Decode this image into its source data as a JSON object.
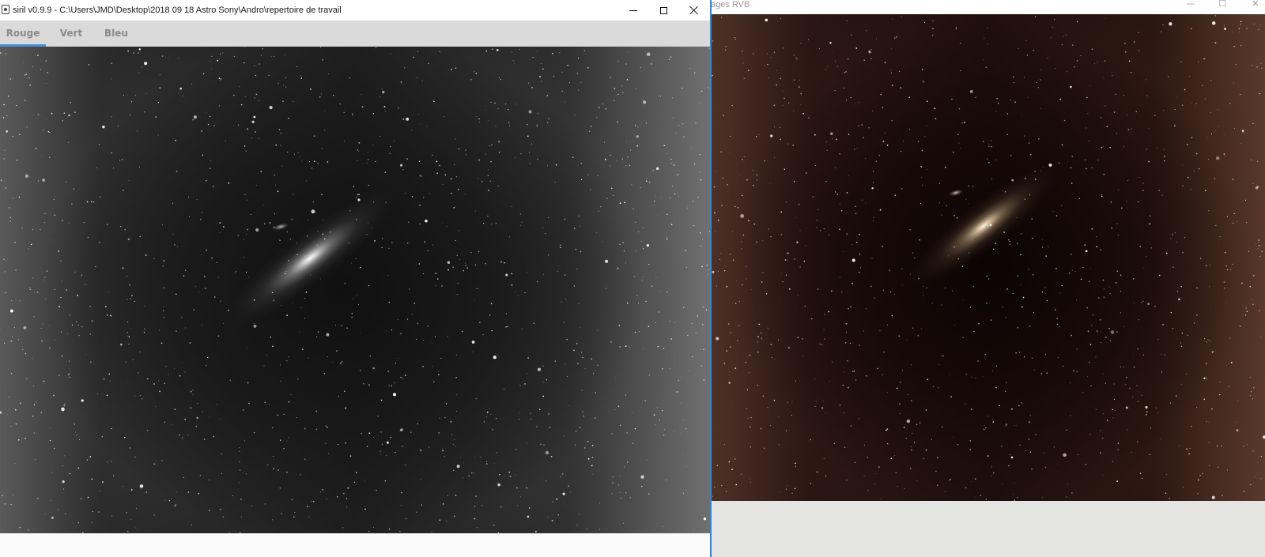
{
  "left_window": {
    "title": "siril v0.9.9 - C:\\Users\\JMD\\Desktop\\2018 09 18 Astro Sony\\Andro\\repertoire de travail",
    "tabs": [
      {
        "label": "Rouge",
        "active": true
      },
      {
        "label": "Vert",
        "active": false
      },
      {
        "label": "Bleu",
        "active": false
      }
    ],
    "accent_color": "#4a90d9",
    "active_border_color": "#2b88d8",
    "icon": "siril-app-icon"
  },
  "right_window": {
    "title": "ages RVB",
    "controls": {
      "minimize": "—",
      "maximize": "☐",
      "close": "✕"
    }
  },
  "window_controls": {
    "minimize_icon": "minimize-icon",
    "maximize_icon": "maximize-icon",
    "close_icon": "close-icon"
  }
}
